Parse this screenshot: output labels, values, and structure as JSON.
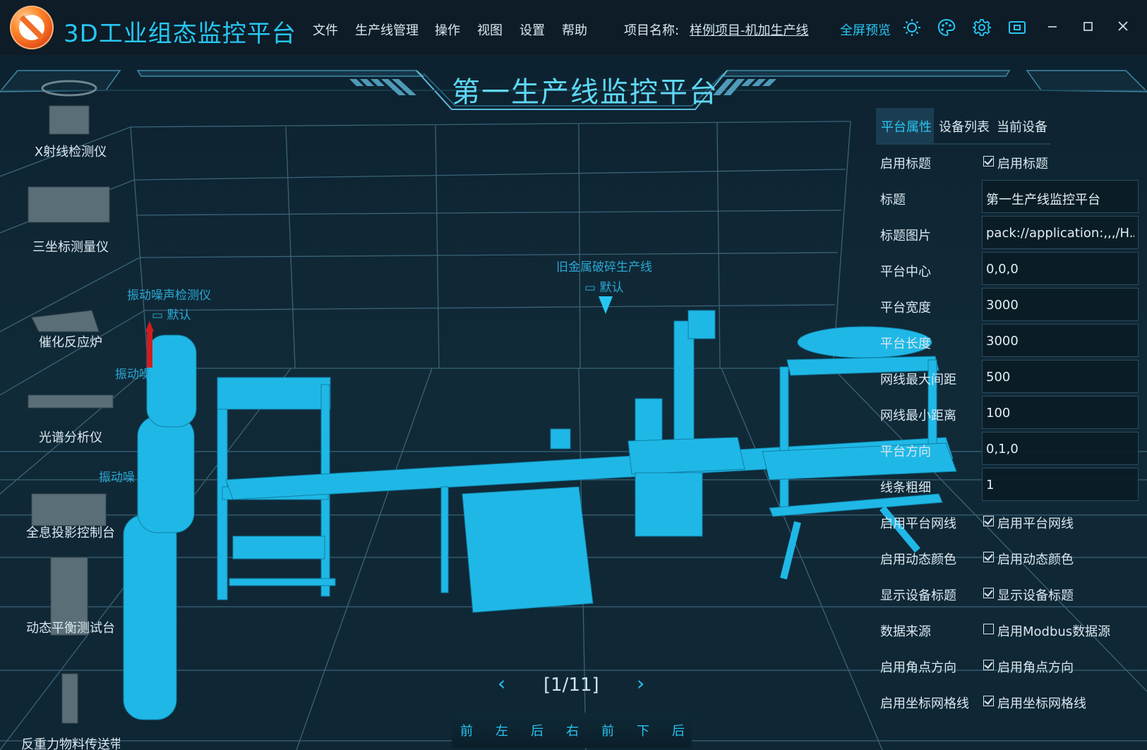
{
  "app": {
    "title": "3D工业组态监控平台",
    "menu": [
      "文件",
      "生产线管理",
      "操作",
      "视图",
      "设置",
      "帮助"
    ],
    "project_label": "项目名称:",
    "project_name": "样例项目-机加生产线",
    "fullscreen": "全屏预览",
    "toolbar_icons": [
      "sun-icon",
      "palette-icon",
      "gear-icon",
      "monitor-icon"
    ],
    "window_controls": [
      "minimize-icon",
      "maximize-icon",
      "close-icon"
    ],
    "accent_color": "#27c6f2"
  },
  "scene": {
    "title": "第一生产线监控平台",
    "labels": {
      "line_name": "旧金属破碎生产线",
      "line_state": "默认",
      "device_name": "振动噪声检测仪",
      "device_state": "默认",
      "device_name_2": "振动噪",
      "device_name_3": "振动噪"
    },
    "pager": {
      "text": "[1/11]",
      "prev": "‹",
      "next": "›"
    },
    "view_buttons": [
      "前",
      "左",
      "后",
      "右",
      "前",
      "下",
      "后"
    ]
  },
  "palette": [
    {
      "name": "X射线检测仪"
    },
    {
      "name": "三坐标测量仪"
    },
    {
      "name": "催化反应炉"
    },
    {
      "name": "光谱分析仪"
    },
    {
      "name": "全息投影控制台"
    },
    {
      "name": "动态平衡测试台"
    },
    {
      "name": "反重力物料传送带"
    }
  ],
  "panel": {
    "tabs": [
      "平台属性",
      "设备列表",
      "当前设备"
    ],
    "active_tab": "平台属性",
    "rows": [
      {
        "label": "启用标题",
        "type": "check",
        "checked": true,
        "text": "启用标题"
      },
      {
        "label": "标题",
        "type": "input",
        "value": "第一生产线监控平台"
      },
      {
        "label": "标题图片",
        "type": "input",
        "value": "pack://application:,,,/H.A"
      },
      {
        "label": "平台中心",
        "type": "input",
        "value": "0,0,0"
      },
      {
        "label": "平台宽度",
        "type": "input",
        "value": "3000"
      },
      {
        "label": "平台长度",
        "type": "input",
        "value": "3000"
      },
      {
        "label": "网线最大间距",
        "type": "input",
        "value": "500"
      },
      {
        "label": "网线最小距离",
        "type": "input",
        "value": "100"
      },
      {
        "label": "平台方向",
        "type": "input",
        "value": "0,1,0"
      },
      {
        "label": "线条粗细",
        "type": "input",
        "value": "1"
      },
      {
        "label": "启用平台网线",
        "type": "check",
        "checked": true,
        "text": "启用平台网线"
      },
      {
        "label": "启用动态颜色",
        "type": "check",
        "checked": true,
        "text": "启用动态颜色"
      },
      {
        "label": "显示设备标题",
        "type": "check",
        "checked": true,
        "text": "显示设备标题"
      },
      {
        "label": "数据来源",
        "type": "check",
        "checked": false,
        "text": "启用Modbus数据源"
      },
      {
        "label": "启用角点方向",
        "type": "check",
        "checked": true,
        "text": "启用角点方向"
      },
      {
        "label": "启用坐标网格线",
        "type": "check",
        "checked": true,
        "text": "启用坐标网格线"
      }
    ]
  }
}
